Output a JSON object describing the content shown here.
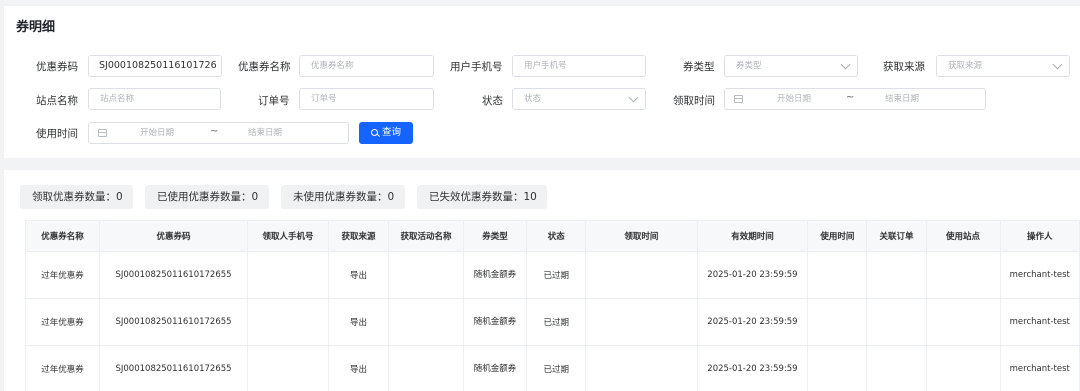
{
  "page_title": "券明细",
  "filters": {
    "coupon_code": {
      "label": "优惠券码",
      "value": "SJ000108250116101726"
    },
    "coupon_name": {
      "label": "优惠券名称",
      "placeholder": "优惠券名称"
    },
    "user_phone": {
      "label": "用户手机号",
      "placeholder": "用户手机号"
    },
    "coupon_type": {
      "label": "券类型",
      "placeholder": "券类型"
    },
    "source": {
      "label": "获取来源",
      "placeholder": "获取来源"
    },
    "site_name": {
      "label": "站点名称",
      "placeholder": "站点名称"
    },
    "order_no": {
      "label": "订单号",
      "placeholder": "订单号"
    },
    "status": {
      "label": "状态",
      "placeholder": "状态"
    },
    "receive_time": {
      "label": "领取时间",
      "start_placeholder": "开始日期",
      "separator": "~",
      "end_placeholder": "结束日期"
    },
    "use_time": {
      "label": "使用时间",
      "start_placeholder": "开始日期",
      "separator": "~",
      "end_placeholder": "结束日期"
    }
  },
  "query_button": "查询",
  "stats": [
    "领取优惠券数量：0",
    "已使用优惠券数量：0",
    "未使用优惠券数量：0",
    "已失效优惠券数量：10"
  ],
  "table": {
    "columns": [
      "优惠券名称",
      "优惠券码",
      "领取人手机号",
      "获取来源",
      "获取活动名称",
      "券类型",
      "状态",
      "领取时间",
      "有效期时间",
      "使用时间",
      "关联订单",
      "使用站点",
      "操作人"
    ],
    "rows": [
      [
        "过年优惠券",
        "SJ000108250116101726​55",
        "",
        "导出",
        "",
        "随机金额券",
        "已过期",
        "",
        "2025-01-20 23:59:59",
        "",
        "",
        "",
        "merchant-test"
      ],
      [
        "过年优惠券",
        "SJ000108250116101726​55",
        "",
        "导出",
        "",
        "随机金额券",
        "已过期",
        "",
        "2025-01-20 23:59:59",
        "",
        "",
        "",
        "merchant-test"
      ],
      [
        "过年优惠券",
        "SJ000108250116101726​55",
        "",
        "导出",
        "",
        "随机金额券",
        "已过期",
        "",
        "2025-01-20 23:59:59",
        "",
        "",
        "",
        "merchant-test"
      ]
    ]
  }
}
